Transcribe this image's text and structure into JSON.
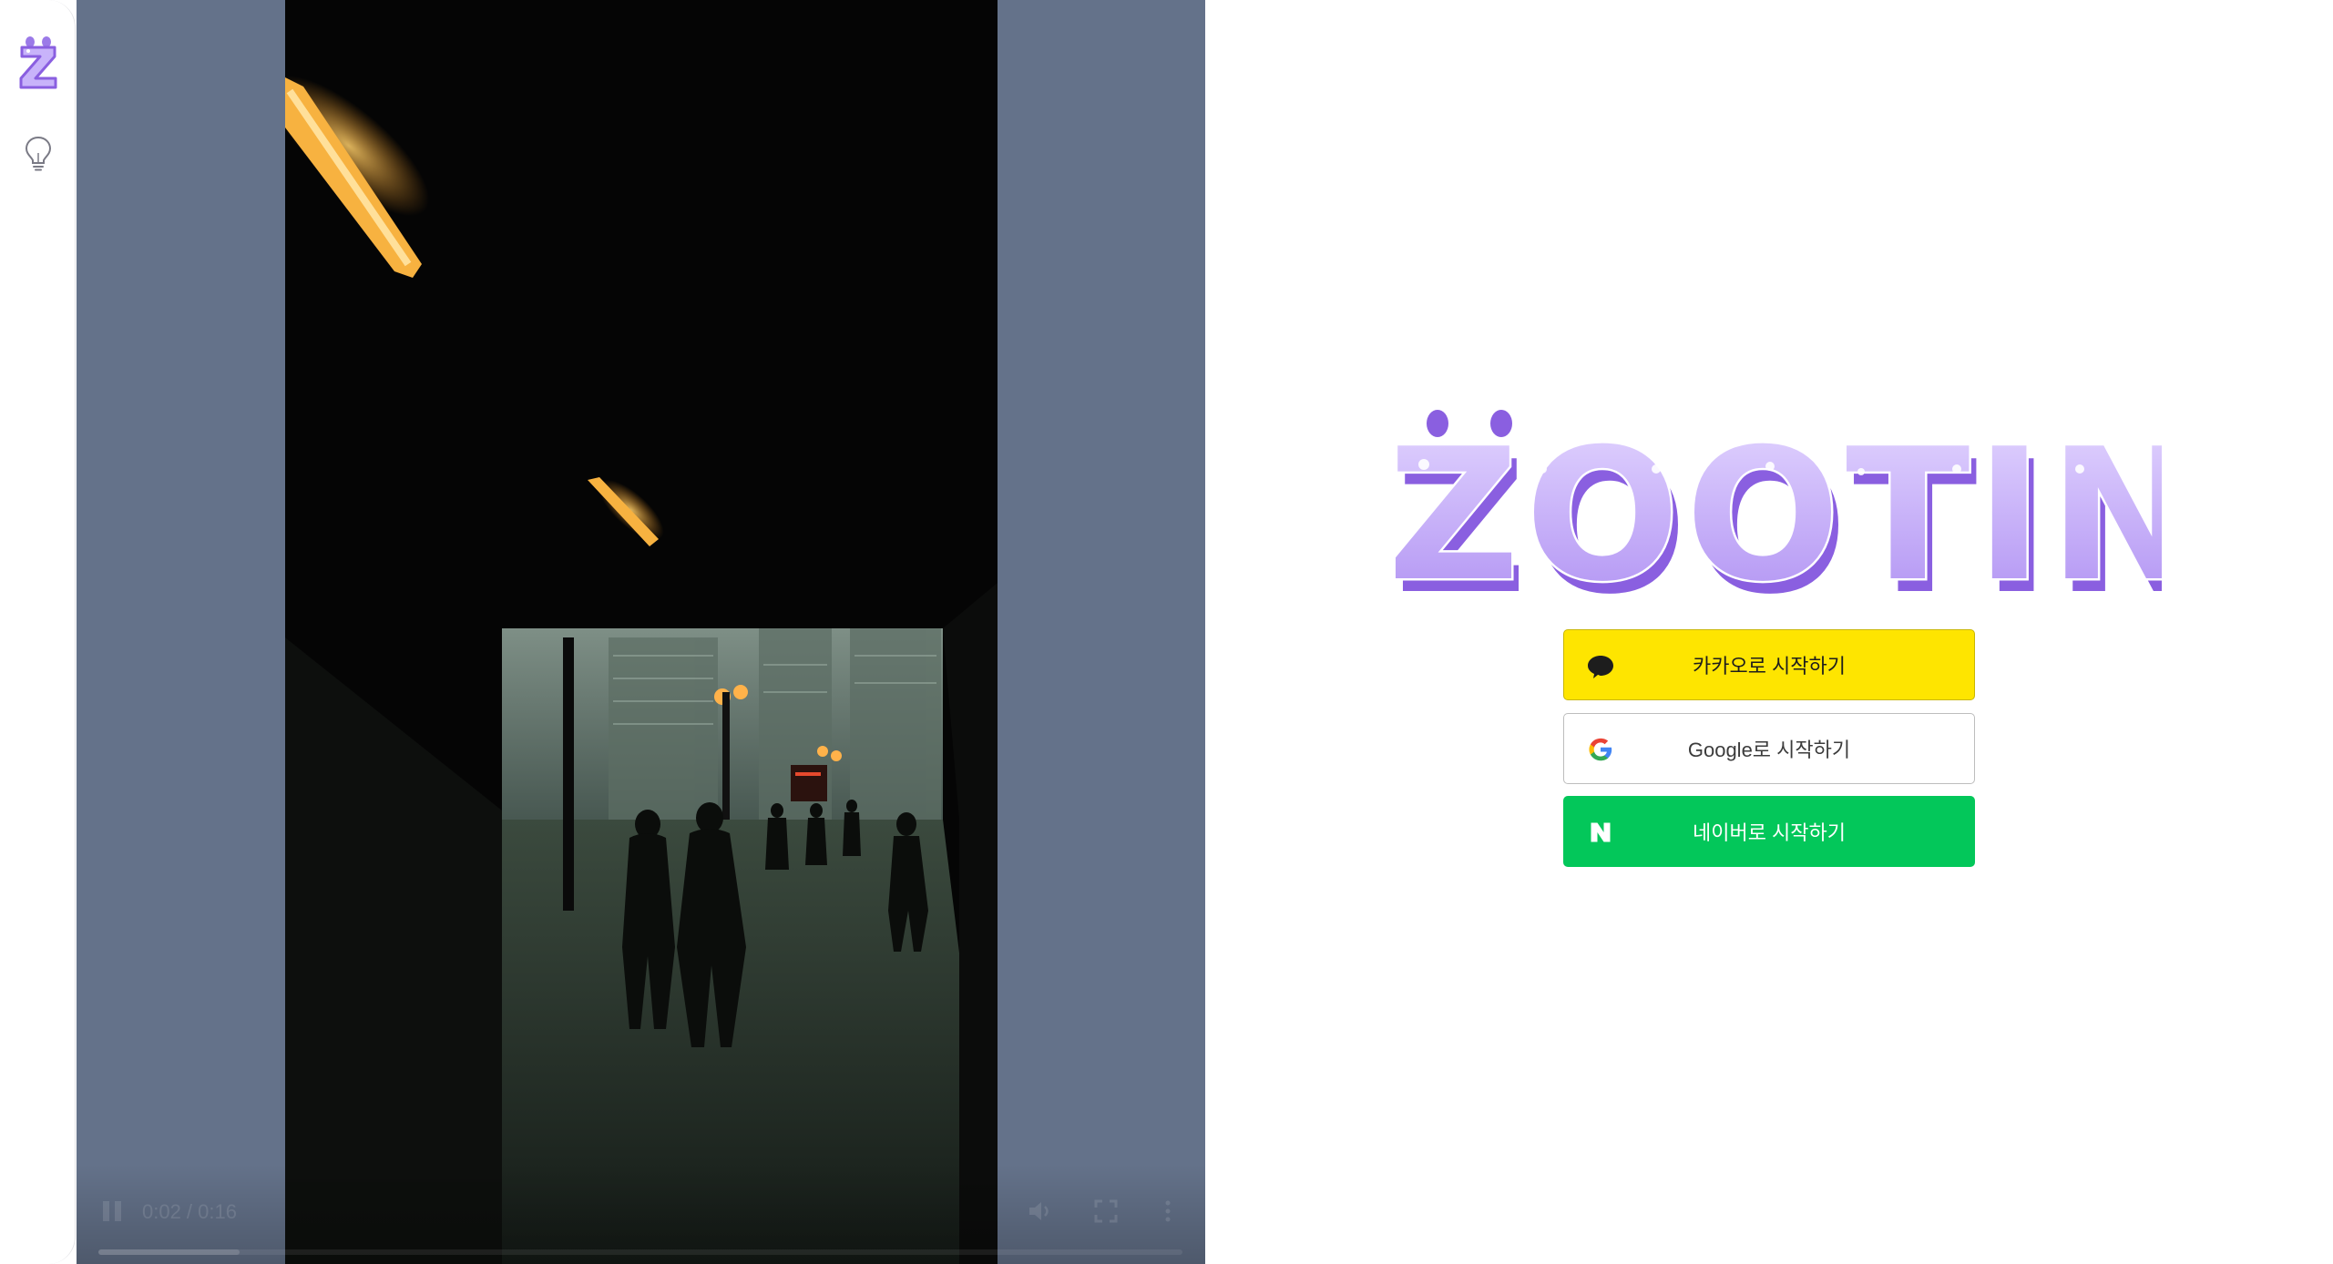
{
  "rail": {
    "logo_icon": "zooting-z-icon",
    "idea_icon": "lightbulb-icon"
  },
  "video": {
    "time_label": "0:02 / 0:16",
    "progress_fraction": 0.13,
    "icons": [
      "pause-icon",
      "volume-icon",
      "fullscreen-icon",
      "more-vertical-icon"
    ]
  },
  "brand": {
    "logo_text": "ZOOTING",
    "primary_color": "#b79cf4",
    "outline_color": "#8a5fe0"
  },
  "login": {
    "kakao_label": "카카오로 시작하기",
    "google_label": "Google로 시작하기",
    "naver_label": "네이버로 시작하기"
  },
  "colors": {
    "kakao": "#fee500",
    "naver": "#03c75a",
    "video_bg": "#64728a"
  }
}
